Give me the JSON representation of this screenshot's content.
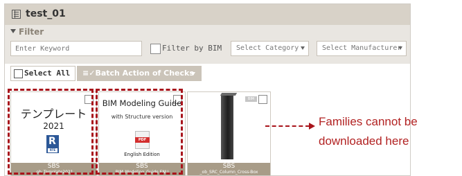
{
  "window": {
    "title": "test_01",
    "title_icon": "list-icon"
  },
  "filter": {
    "heading": "Filter",
    "heading_icon": "funnel-icon",
    "keyword_placeholder": "Enter Keyword",
    "filter_by_bim_label": "Filter by BIM",
    "category_select": "Select Category",
    "manufacturer_select": "Select Manufacturer"
  },
  "actions": {
    "select_all": "Select All",
    "batch_action": "Batch Action of Checks"
  },
  "cards": [
    {
      "title": "テンプレート",
      "year": "2021",
      "icon": "revit-template-icon",
      "icon_ext": "RTE",
      "vendor": "SBS",
      "file": "_ob_Template2021"
    },
    {
      "title": "BIM Modeling Guide",
      "subtitle": "with Structure version",
      "icon": "pdf-icon",
      "icon_ext": "PDF",
      "edition": "English Edition",
      "vendor": "SBS",
      "file": "BIM_Modeling_Guide ENU"
    },
    {
      "badge": "BIM",
      "vendor": "SBS",
      "file": "_ob_SRC_Column_Cross-Box"
    }
  ],
  "annotation": {
    "line1": "Families cannot be",
    "line2": "downloaded here",
    "color": "#a8141b"
  }
}
